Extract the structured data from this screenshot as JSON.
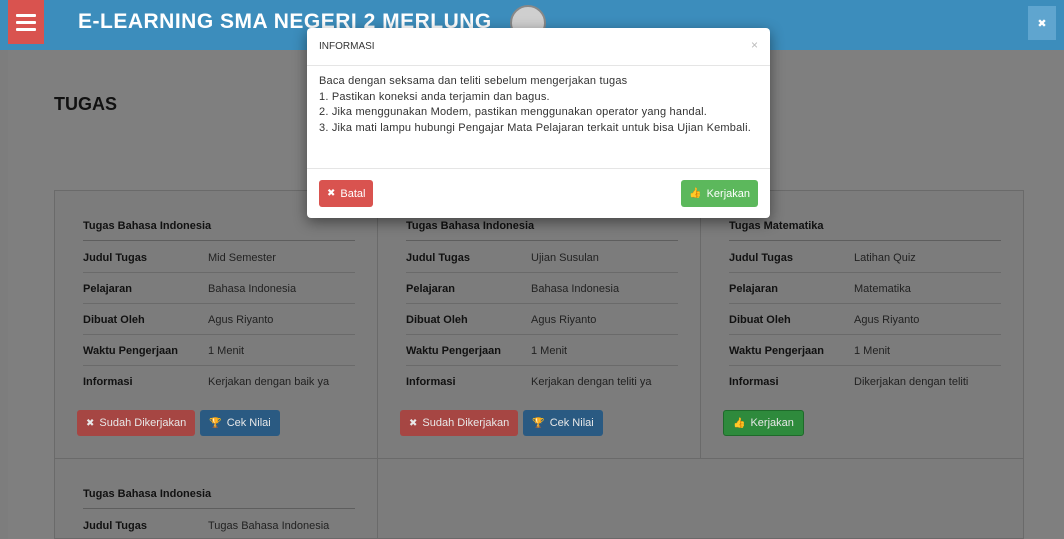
{
  "navbar": {
    "brand": "E-LEARNING SMA NEGERI 2 MERLUNG",
    "close_label": "✖"
  },
  "page": {
    "title": "TUGAS"
  },
  "field_labels": {
    "judul": "Judul Tugas",
    "pelajaran": "Pelajaran",
    "dibuat": "Dibuat Oleh",
    "waktu": "Waktu Pengerjaan",
    "informasi": "Informasi"
  },
  "cards": [
    {
      "heading": "Tugas Bahasa Indonesia",
      "judul": "Mid Semester",
      "pelajaran": "Bahasa Indonesia",
      "dibuat": "Agus Riyanto",
      "waktu": "1 Menit",
      "informasi": "Kerjakan dengan baik ya",
      "done_label": "Sudah Dikerjakan",
      "nilai_label": "Cek Nilai"
    },
    {
      "heading": "Tugas Bahasa Indonesia",
      "judul": "Ujian Susulan",
      "pelajaran": "Bahasa Indonesia",
      "dibuat": "Agus Riyanto",
      "waktu": "1 Menit",
      "informasi": "Kerjakan dengan teliti ya",
      "done_label": "Sudah Dikerjakan",
      "nilai_label": "Cek Nilai"
    },
    {
      "heading": "Tugas Matematika",
      "judul": "Latihan Quiz",
      "pelajaran": "Matematika",
      "dibuat": "Agus Riyanto",
      "waktu": "1 Menit",
      "informasi": "Dikerjakan dengan teliti",
      "do_label": "Kerjakan"
    },
    {
      "heading": "Tugas Bahasa Indonesia",
      "judul": "Tugas Bahasa Indonesia"
    }
  ],
  "modal": {
    "title": "INFORMASI",
    "close": "×",
    "lines": [
      "Baca dengan seksama dan teliti sebelum mengerjakan tugas",
      "1. Pastikan koneksi anda terjamin dan bagus.",
      "2. Jika menggunakan Modem, pastikan menggunakan operator yang handal.",
      "3. Jika mati lampu hubungi Pengajar Mata Pelajaran terkait untuk bisa Ujian Kembali."
    ],
    "cancel_label": "Batal",
    "ok_label": "Kerjakan"
  },
  "colors": {
    "navbar": "#3c8dbc",
    "danger": "#d9534f",
    "success": "#5cb85c",
    "primary": "#337ab7"
  }
}
